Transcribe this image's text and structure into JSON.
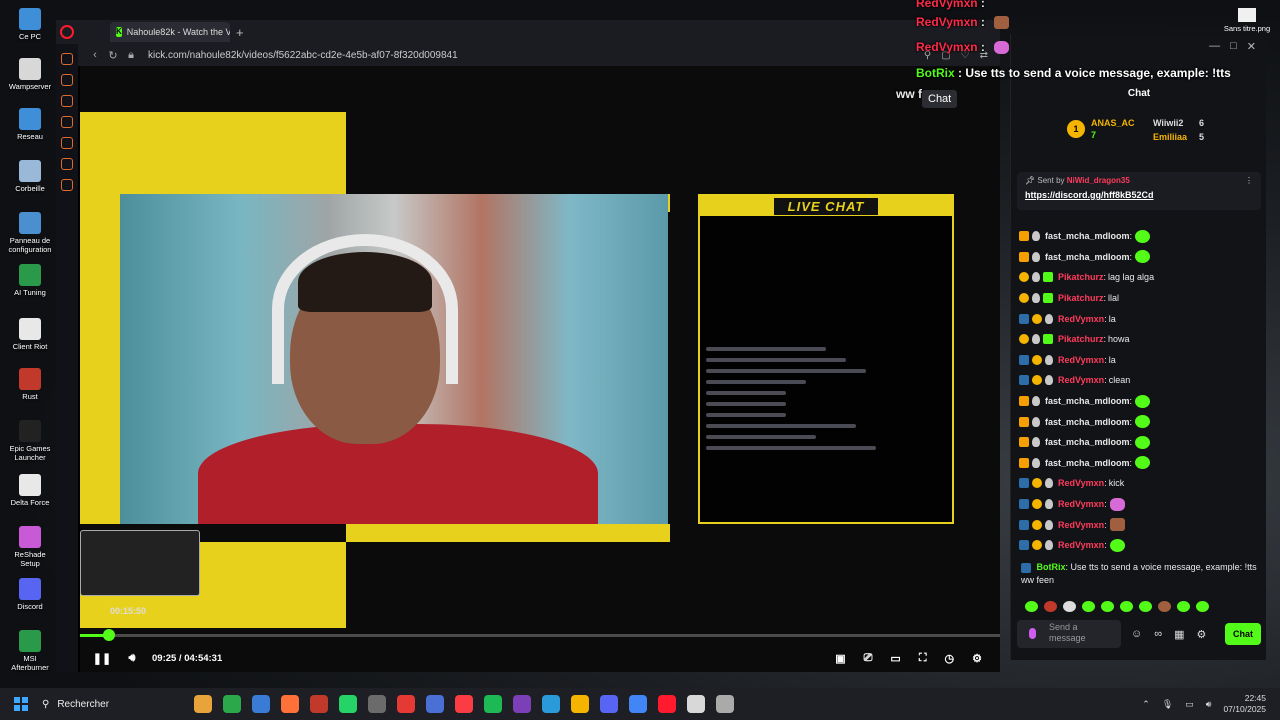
{
  "desktop": {
    "icons": [
      {
        "label": "Ce PC",
        "color": "#3e8ed8"
      },
      {
        "label": "Wampserver",
        "color": "#d8d8d8"
      },
      {
        "label": "Reseau",
        "color": "#3e8ed8"
      },
      {
        "label": "Corbeille",
        "color": "#9ab8d8"
      },
      {
        "label": "Panneau de configuration",
        "color": "#4a8fd0"
      },
      {
        "label": "AI Tuning",
        "color": "#2a9a4a"
      },
      {
        "label": "Client Riot",
        "color": "#e8e8e8"
      },
      {
        "label": "Rust",
        "color": "#c0392b"
      },
      {
        "label": "Epic Games Launcher",
        "color": "#222222"
      },
      {
        "label": "Delta Force",
        "color": "#e8e8e8"
      },
      {
        "label": "ReShade Setup",
        "color": "#c85ad8"
      },
      {
        "label": "Discord",
        "color": "#5865f2"
      },
      {
        "label": "MSI Afterburner",
        "color": "#2a9a4a"
      }
    ],
    "file_label": "Sans titre.png"
  },
  "browser": {
    "tab_title": "Nahoule82k - Watch the V",
    "url": "kick.com/nahoule82k/videos/f5622abc-cd2e-4e5b-af07-8f320d009841"
  },
  "video": {
    "overlay_title": "LIVE CHAT",
    "thumb_time": "00:15:50",
    "time_display": "09:25 / 04:54:31",
    "progress": 0.032
  },
  "chat": {
    "header": "Chat",
    "leaderboard": [
      {
        "name": "ANAS_AC",
        "count": "7"
      },
      {
        "name": "Wiiwii2",
        "count": "6"
      },
      {
        "name": "Emiliiaa",
        "count": "5"
      }
    ],
    "pinned": {
      "sent_by": "Sent by",
      "user": "NiWid_dragon35",
      "link": "https://discord.gg/hff8kB52Cd"
    },
    "messages": [
      {
        "user": "fast_mcha_mdloom",
        "text": "",
        "color": "#e8e8e8",
        "badges": [
          "crown",
          "shield"
        ],
        "emote": "green"
      },
      {
        "user": "fast_mcha_mdloom",
        "text": "",
        "color": "#e8e8e8",
        "badges": [
          "crown",
          "shield"
        ],
        "emote": "green"
      },
      {
        "user": "Pikatchurz",
        "text": "lag lag alga",
        "color": "#ff3b5c",
        "badges": [
          "gold",
          "shield",
          "green"
        ],
        "emote": ""
      },
      {
        "user": "Pikatchurz",
        "text": "llal",
        "color": "#ff3b5c",
        "badges": [
          "gold",
          "shield",
          "green"
        ],
        "emote": ""
      },
      {
        "user": "RedVymxn",
        "text": "la",
        "color": "#ff3b5c",
        "badges": [
          "blue",
          "gold",
          "shield"
        ],
        "emote": ""
      },
      {
        "user": "Pikatchurz",
        "text": "howa",
        "color": "#ff3b5c",
        "badges": [
          "gold",
          "shield",
          "green"
        ],
        "emote": ""
      },
      {
        "user": "RedVymxn",
        "text": "la",
        "color": "#ff3b5c",
        "badges": [
          "blue",
          "gold",
          "shield"
        ],
        "emote": ""
      },
      {
        "user": "RedVymxn",
        "text": "clean",
        "color": "#ff3b5c",
        "badges": [
          "blue",
          "gold",
          "shield"
        ],
        "emote": ""
      },
      {
        "user": "fast_mcha_mdloom",
        "text": "",
        "color": "#e8e8e8",
        "badges": [
          "crown",
          "shield"
        ],
        "emote": "green"
      },
      {
        "user": "fast_mcha_mdloom",
        "text": "",
        "color": "#e8e8e8",
        "badges": [
          "crown",
          "shield"
        ],
        "emote": "green"
      },
      {
        "user": "fast_mcha_mdloom",
        "text": "",
        "color": "#e8e8e8",
        "badges": [
          "crown",
          "shield"
        ],
        "emote": "green"
      },
      {
        "user": "fast_mcha_mdloom",
        "text": "",
        "color": "#e8e8e8",
        "badges": [
          "crown",
          "shield"
        ],
        "emote": "green"
      },
      {
        "user": "RedVymxn",
        "text": "kick",
        "color": "#ff3b5c",
        "badges": [
          "blue",
          "gold",
          "shield"
        ],
        "emote": ""
      },
      {
        "user": "RedVymxn",
        "text": "",
        "color": "#ff3b5c",
        "badges": [
          "blue",
          "gold",
          "shield"
        ],
        "emote": "pink"
      },
      {
        "user": "RedVymxn",
        "text": "",
        "color": "#ff3b5c",
        "badges": [
          "blue",
          "gold",
          "shield"
        ],
        "emote": "face"
      },
      {
        "user": "RedVymxn",
        "text": "",
        "color": "#ff3b5c",
        "badges": [
          "blue",
          "gold",
          "shield"
        ],
        "emote": "green"
      }
    ],
    "bot_message": {
      "user": "BotRix",
      "text": "Use tts to send a voice message, example: !tts ww feen"
    },
    "input_placeholder": "Send a message",
    "send_label": "Chat"
  },
  "overlay": {
    "lines": [
      {
        "user": "RedVymxn",
        "text": ":"
      },
      {
        "user": "RedVymxn",
        "text": ":"
      },
      {
        "user": "RedVymxn",
        "text": ":"
      }
    ],
    "bot_user": "BotRix",
    "bot_text": ": Use tts to send a voice message, example: !tts",
    "bot_cont": "ww feen",
    "chat_button": "Chat"
  },
  "taskbar": {
    "search_placeholder": "Rechercher",
    "time": "22:45",
    "date": "07/10/2025",
    "apps": [
      "#e8a33a",
      "#2aa84a",
      "#3a7bd5",
      "#ff7139",
      "#c0392b",
      "#25d366",
      "#6b6b6b",
      "#e53935",
      "#4a6fd5",
      "#fc3c44",
      "#1db954",
      "#7b3fb8",
      "#2a9ad8",
      "#f5b400",
      "#5865f2",
      "#4285f4",
      "#ff1b2d",
      "#d8d8d8",
      "#aaaaaa"
    ]
  }
}
